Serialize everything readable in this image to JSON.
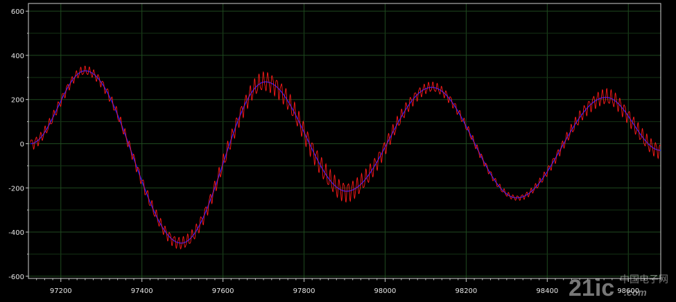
{
  "chart_data": {
    "type": "line",
    "title": "",
    "xlabel": "",
    "ylabel": "",
    "xlim": [
      97120,
      98680
    ],
    "ylim": [
      -610,
      635
    ],
    "grid": true,
    "legend": "none",
    "x_ticks": [
      "97200",
      "97400",
      "97600",
      "97800",
      "98000",
      "98200",
      "98400",
      "98600"
    ],
    "y_ticks": [
      "600",
      "400",
      "200",
      "0",
      "-200",
      "-400",
      "-600"
    ],
    "background_color": "#000000",
    "grid_color": "#1f4a1f",
    "series": [
      {
        "color": "#1a1aff",
        "style": "smooth",
        "x": [
          97125,
          97260,
          97497,
          97705,
          97905,
          98115,
          98325,
          98545,
          98680
        ],
        "y": [
          0,
          330,
          -450,
          280,
          -215,
          255,
          -245,
          210,
          -30
        ]
      },
      {
        "color": "#ff1a1a",
        "style": "noisy",
        "oscillation_period": 11,
        "x": [
          97125,
          97260,
          97497,
          97705,
          97905,
          98115,
          98325,
          98545,
          98680
        ],
        "y": [
          0,
          330,
          -450,
          280,
          -215,
          255,
          -245,
          210,
          -30
        ],
        "amplitude": [
          28,
          22,
          30,
          48,
          50,
          25,
          12,
          40,
          38
        ]
      }
    ]
  },
  "watermark": {
    "text": "21ic",
    "subtext": "中国电子网",
    "domain": ".com"
  }
}
